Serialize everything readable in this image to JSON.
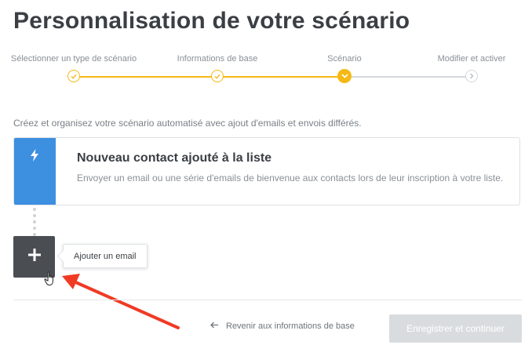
{
  "page": {
    "title": "Personnalisation de votre scénario"
  },
  "stepper": {
    "steps": [
      {
        "label": "Sélectionner un type de scénario",
        "state": "completed"
      },
      {
        "label": "Informations de base",
        "state": "completed"
      },
      {
        "label": "Scénario",
        "state": "current"
      },
      {
        "label": "Modifier et activer",
        "state": "upcoming"
      }
    ],
    "colors": {
      "active": "#f5b914",
      "inactive": "#d5d8dc"
    }
  },
  "intro_text": "Créez et organisez votre scénario automatisé avec ajout d'emails et envois différés.",
  "trigger": {
    "icon": "lightning-bolt-icon",
    "title": "Nouveau contact ajouté à la liste",
    "description": "Envoyer un email ou une série d'emails de bienvenue aux contacts lors de leur inscription à votre liste.",
    "accent_color": "#3d8fe0"
  },
  "add_email": {
    "icon": "plus-icon",
    "tooltip": "Ajouter un email"
  },
  "footer": {
    "back_label": "Revenir aux informations de base",
    "save_label": "Enregistrer et continuer"
  },
  "annotation": {
    "arrow_color": "#f03a24"
  }
}
